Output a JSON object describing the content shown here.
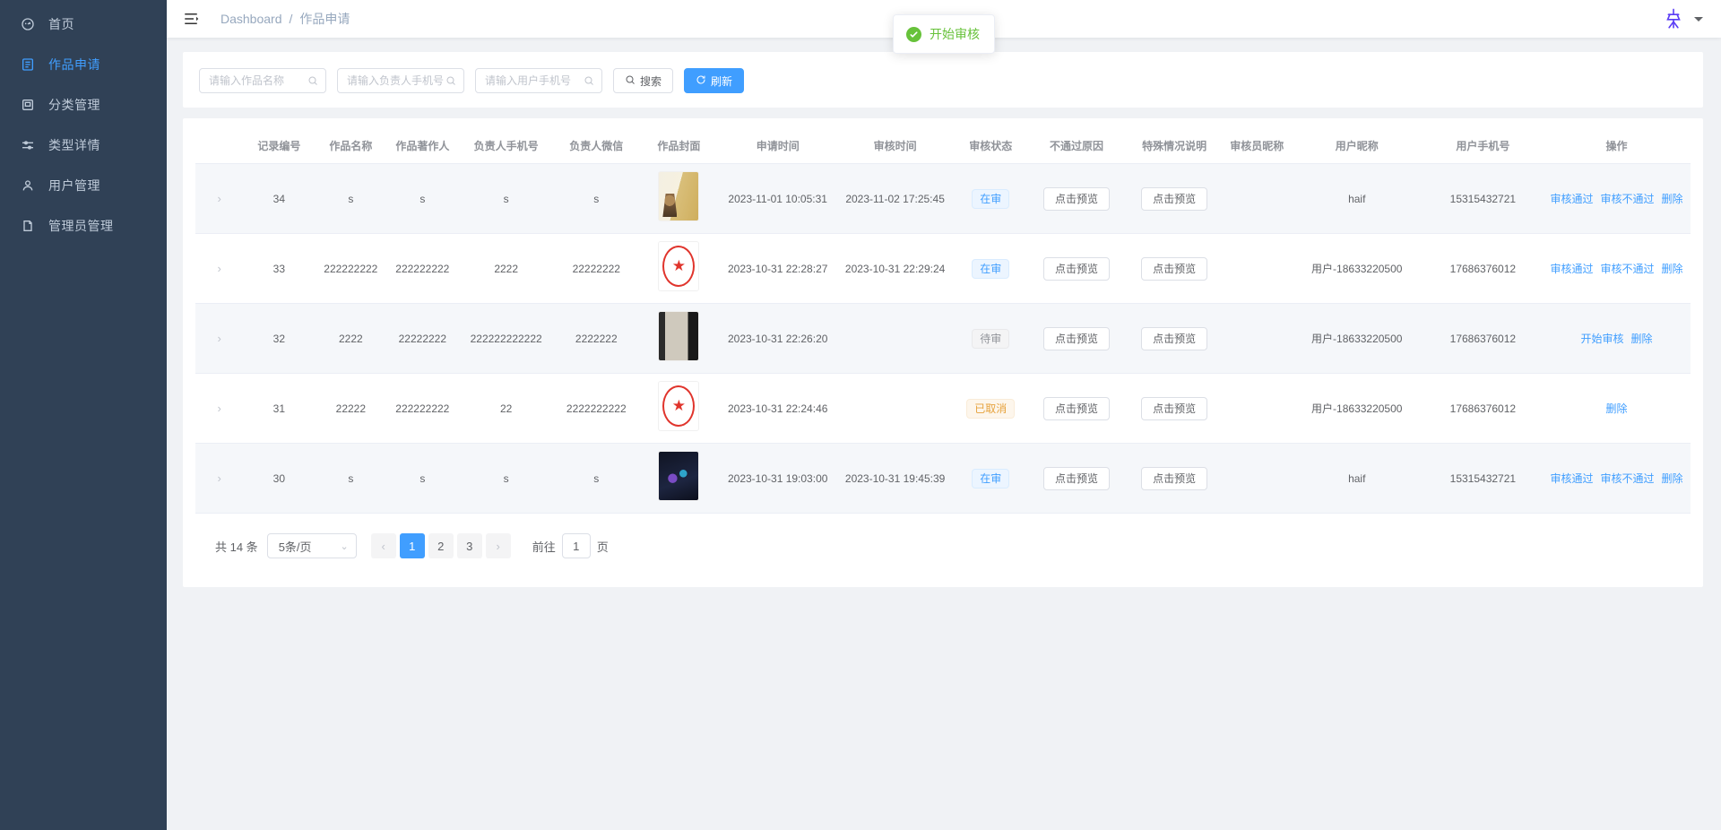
{
  "sidebar": {
    "items": [
      {
        "label": "首页",
        "icon": "dashboard-icon",
        "active": false
      },
      {
        "label": "作品申请",
        "icon": "document-icon",
        "active": true
      },
      {
        "label": "分类管理",
        "icon": "archive-icon",
        "active": false
      },
      {
        "label": "类型详情",
        "icon": "sliders-icon",
        "active": false
      },
      {
        "label": "用户管理",
        "icon": "user-icon",
        "active": false
      },
      {
        "label": "管理员管理",
        "icon": "admin-icon",
        "active": false
      }
    ]
  },
  "navbar": {
    "breadcrumb_root": "Dashboard",
    "breadcrumb_sep": "/",
    "breadcrumb_current": "作品申请"
  },
  "toast": {
    "message": "开始审核",
    "color": "#67c23a"
  },
  "filters": {
    "work_name": {
      "placeholder": "请输入作品名称",
      "value": ""
    },
    "owner_phone": {
      "placeholder": "请输入负责人手机号",
      "value": ""
    },
    "user_phone": {
      "placeholder": "请输入用户手机号",
      "value": ""
    },
    "search_label": "搜索",
    "refresh_label": "刷新"
  },
  "table": {
    "headers": [
      "",
      "记录编号",
      "作品名称",
      "作品著作人",
      "负责人手机号",
      "负责人微信",
      "作品封面",
      "申请时间",
      "审核时间",
      "审核状态",
      "不通过原因",
      "特殊情况说明",
      "审核员昵称",
      "用户昵称",
      "用户手机号",
      "操作"
    ],
    "preview_label": "点击预览",
    "rows": [
      {
        "id": "34",
        "work_name": "s",
        "author": "s",
        "owner_phone": "s",
        "owner_wechat": "s",
        "cover": "c1",
        "apply_time": "2023-11-01 10:05:31",
        "audit_time": "2023-11-02 17:25:45",
        "status": "在审",
        "status_type": "blue",
        "reject_reason": "点击预览",
        "special_note": "点击预览",
        "auditor": "",
        "user_nick": "haif",
        "user_phone": "15315432721",
        "actions": [
          "审核通过",
          "审核不通过",
          "删除"
        ]
      },
      {
        "id": "33",
        "work_name": "222222222",
        "author": "222222222",
        "owner_phone": "2222",
        "owner_wechat": "22222222",
        "cover": "stamp",
        "apply_time": "2023-10-31 22:28:27",
        "audit_time": "2023-10-31 22:29:24",
        "status": "在审",
        "status_type": "blue",
        "reject_reason": "点击预览",
        "special_note": "点击预览",
        "auditor": "",
        "user_nick": "用户-18633220500",
        "user_phone": "17686376012",
        "actions": [
          "审核通过",
          "审核不通过",
          "删除"
        ]
      },
      {
        "id": "32",
        "work_name": "2222",
        "author": "22222222",
        "owner_phone": "222222222222",
        "owner_wechat": "2222222",
        "cover": "c3",
        "apply_time": "2023-10-31 22:26:20",
        "audit_time": "",
        "status": "待审",
        "status_type": "gray",
        "reject_reason": "点击预览",
        "special_note": "点击预览",
        "auditor": "",
        "user_nick": "用户-18633220500",
        "user_phone": "17686376012",
        "actions": [
          "开始审核",
          "删除"
        ]
      },
      {
        "id": "31",
        "work_name": "22222",
        "author": "222222222",
        "owner_phone": "22",
        "owner_wechat": "2222222222",
        "cover": "stamp",
        "apply_time": "2023-10-31 22:24:46",
        "audit_time": "",
        "status": "已取消",
        "status_type": "orange",
        "reject_reason": "点击预览",
        "special_note": "点击预览",
        "auditor": "",
        "user_nick": "用户-18633220500",
        "user_phone": "17686376012",
        "actions": [
          "删除"
        ]
      },
      {
        "id": "30",
        "work_name": "s",
        "author": "s",
        "owner_phone": "s",
        "owner_wechat": "s",
        "cover": "c5",
        "apply_time": "2023-10-31 19:03:00",
        "audit_time": "2023-10-31 19:45:39",
        "status": "在审",
        "status_type": "blue",
        "reject_reason": "点击预览",
        "special_note": "点击预览",
        "auditor": "",
        "user_nick": "haif",
        "user_phone": "15315432721",
        "actions": [
          "审核通过",
          "审核不通过",
          "删除"
        ]
      }
    ]
  },
  "pagination": {
    "total_text": "共 14 条",
    "page_size_label": "5条/页",
    "prev_icon": "‹",
    "next_icon": "›",
    "pages": [
      "1",
      "2",
      "3"
    ],
    "current_page": "1",
    "jump_prefix": "前往",
    "jump_value": "1",
    "jump_suffix": "页"
  }
}
